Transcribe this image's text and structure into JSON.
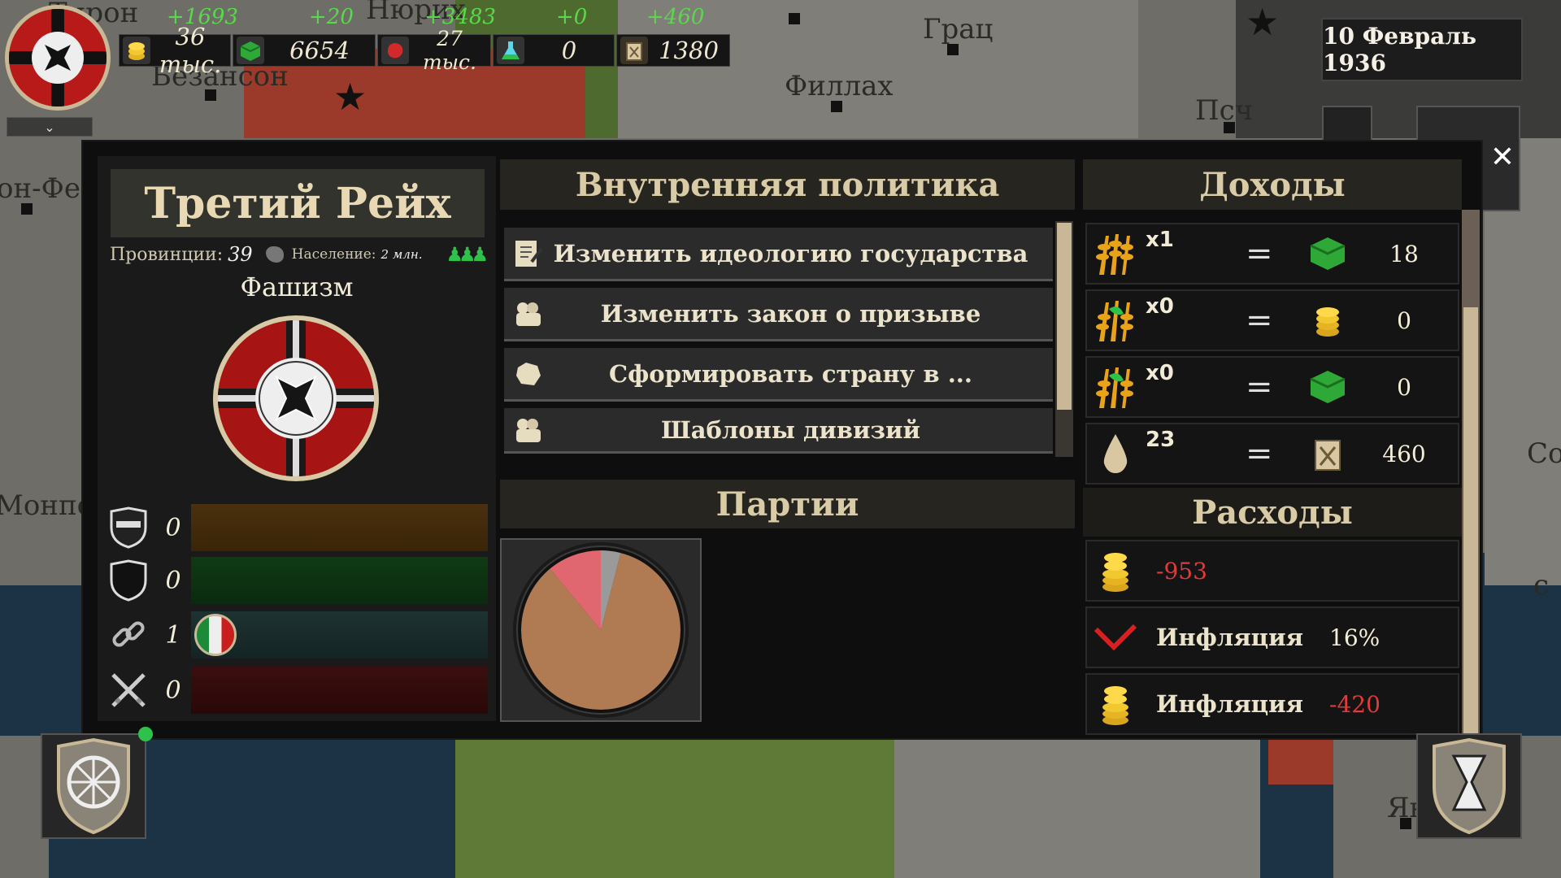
{
  "map": {
    "labels": [
      "Тирон",
      "Нюрих",
      "Безансон",
      "Грац",
      "Филлах",
      "Псч",
      "он-Фер",
      "Монпе.",
      "Со",
      "Яни",
      "с"
    ]
  },
  "topbar": {
    "resources": [
      {
        "icon": "gold-coins-icon",
        "value": "36 тыс.",
        "delta": "+1693"
      },
      {
        "icon": "green-goods-icon",
        "value": "6654",
        "delta": "+20"
      },
      {
        "icon": "red-meat-icon",
        "value": "27 тыс.",
        "delta": "+3483"
      },
      {
        "icon": "science-flask-icon",
        "value": "0",
        "delta": "+0"
      },
      {
        "icon": "fuel-canister-icon",
        "value": "1380",
        "delta": "+460"
      }
    ],
    "date": "10 Февраль 1936"
  },
  "country": {
    "name": "Третий Рейх",
    "provinces_label": "Провинции:",
    "provinces_value": "39",
    "population_label": "Население:",
    "population_value": "2 млн.",
    "ideology": "Фашизм"
  },
  "relations": [
    {
      "icon": "masked-shield-icon",
      "value": "0",
      "color": "#5a3a10"
    },
    {
      "icon": "shield-icon",
      "value": "0",
      "color": "#0f3a14"
    },
    {
      "icon": "chain-link-icon",
      "value": "1",
      "color": "#1b2e2e"
    },
    {
      "icon": "crossed-swords-icon",
      "value": "0",
      "color": "#3a0e0e"
    }
  ],
  "domestic_policy": {
    "title": "Внутренняя политика",
    "buttons": [
      "Изменить идеологию государства",
      "Изменить закон о призыве",
      "Сформировать страну в ...",
      "Шаблоны дивизий"
    ]
  },
  "parties": {
    "title": "Партии",
    "chart_data": {
      "type": "pie",
      "title": "",
      "series": [
        {
          "value": 85,
          "color": "#b07a52"
        },
        {
          "value": 11,
          "color": "#e06670"
        },
        {
          "value": 4,
          "color": "#9a9a9a"
        }
      ]
    }
  },
  "income": {
    "title": "Доходы",
    "rows": [
      {
        "icon": "wheat-icon",
        "mult": "x1",
        "result_icon": "green-goods-icon",
        "result": "18"
      },
      {
        "icon": "wheat-leaf-icon",
        "mult": "x0",
        "result_icon": "gold-coins-icon",
        "result": "0"
      },
      {
        "icon": "wheat-leaf-icon",
        "mult": "x0",
        "result_icon": "green-goods-icon",
        "result": "0"
      },
      {
        "icon": "oil-drop-icon",
        "mult": "23",
        "result_icon": "fuel-canister-icon",
        "result": "460"
      }
    ]
  },
  "expenses": {
    "title": "Расходы",
    "rows": [
      {
        "icon": "gold-coins-icon",
        "label": "",
        "value": "-953",
        "color": "#e03a3a"
      },
      {
        "icon": "red-check-icon",
        "label": "Инфляция",
        "value": "16%",
        "color": "#f4eed8"
      },
      {
        "icon": "gold-coins-icon",
        "label": "Инфляция",
        "value": "-420",
        "color": "#e03a3a"
      }
    ]
  }
}
